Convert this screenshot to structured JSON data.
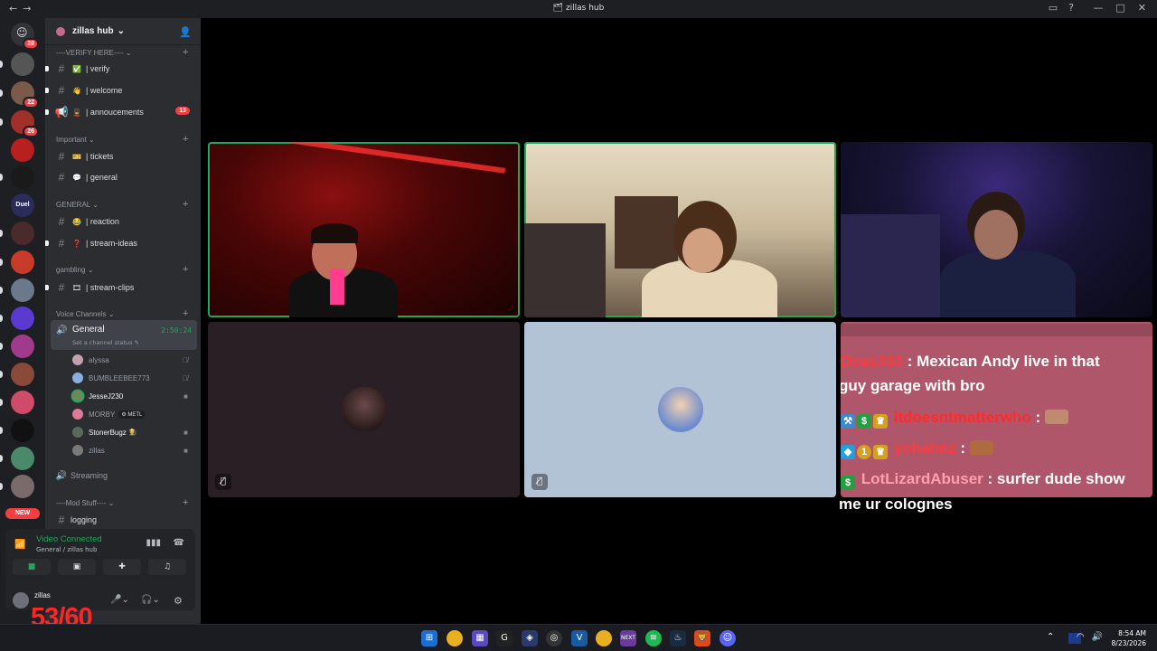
{
  "window": {
    "title": "zillas hub",
    "nav_back": "←",
    "nav_fwd": "→"
  },
  "colors": {
    "speaking": "#23a55a",
    "alert": "#f23f43",
    "chat_bg": "#b0566a",
    "fps": "#ff2626"
  },
  "server_rail": {
    "home_badge": "28",
    "badges": [
      {
        "value": "22"
      },
      {
        "value": "26"
      }
    ],
    "duel_label": "Duel",
    "new_label": "NEW"
  },
  "server": {
    "name": "zillas hub"
  },
  "categories": [
    {
      "label": "----VERIFY HERE---- ⌄"
    },
    {
      "label": "Important ⌄"
    },
    {
      "label": "GENERAL ⌄"
    },
    {
      "label": "gambling ⌄"
    },
    {
      "label": "Voice Channels ⌄"
    },
    {
      "label": "----Mod Stuff---- ⌄"
    }
  ],
  "channels": [
    {
      "emoji": "✅",
      "label": "| verify"
    },
    {
      "emoji": "👋",
      "label": "| welcome"
    },
    {
      "emoji": "💂",
      "label": "| annoucements",
      "count": "13"
    },
    {
      "emoji": "🎫",
      "label": "| tickets"
    },
    {
      "emoji": "💬",
      "label": "| general"
    },
    {
      "emoji": "😂",
      "label": "| reaction"
    },
    {
      "emoji": "❓",
      "label": "| stream-ideas"
    },
    {
      "emoji": "🎞",
      "label": "| stream-clips"
    },
    {
      "label": "logging"
    }
  ],
  "voice": {
    "active_channel": "General",
    "timer": "2:50:24",
    "status_prompt": "Set a channel status",
    "members": [
      {
        "name": "alyssa"
      },
      {
        "name": "BUMBLEEBEE773"
      },
      {
        "name": "JesseJ230"
      },
      {
        "name": "MORBY",
        "tag": "METL"
      },
      {
        "name": "StonerBugz"
      },
      {
        "name": "zillas"
      }
    ],
    "other_channel": "Streaming"
  },
  "connection": {
    "status": "Video Connected",
    "location": "General / zillas hub"
  },
  "user": {
    "name": "zillas"
  },
  "overlay": {
    "fps": "53/60"
  },
  "chat_overlay": {
    "lines": [
      {
        "user": "Dcas333",
        "text": ": Mexican Andy live in that"
      },
      {
        "text": "guy garage with bro"
      },
      {
        "user": "itdoesntmatterwho",
        "text": ":"
      },
      {
        "user": "yohahnz",
        "text": ":"
      },
      {
        "user": "LotLizardAbuser",
        "text": ": surfer dude show"
      },
      {
        "text": "me ur colognes"
      }
    ]
  },
  "taskbar": {
    "time": "8:54 AM",
    "date": "8/23/2026"
  }
}
